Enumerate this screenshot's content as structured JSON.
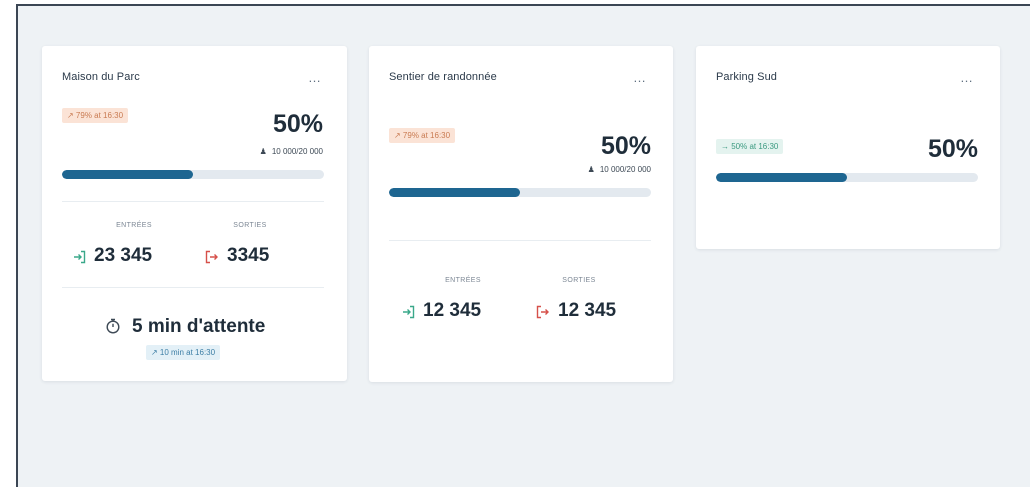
{
  "colors": {
    "background": "#eef2f5",
    "card": "#ffffff",
    "bar_fill": "#1e6691",
    "bar_track": "#e3e9ef",
    "trend_up": "#c97b52",
    "trend_flat": "#3b9a80",
    "entry_icon": "#3aa88a",
    "exit_icon": "#d6504a"
  },
  "cards": [
    {
      "title": "Maison du Parc",
      "menu": "…",
      "trend": "↗ 79% at 16:30",
      "percent": "50%",
      "percent_value": 50,
      "capacity": "10 000/20 000",
      "entries_label": "ENTRÉES",
      "exits_label": "SORTIES",
      "entries_value": "23 345",
      "exits_value": "3345",
      "wait": "5 min d'attente",
      "wait_trend": "↗ 10 min at 16:30"
    },
    {
      "title": "Sentier de randonnée",
      "menu": "…",
      "trend": "↗ 79% at 16:30",
      "percent": "50%",
      "percent_value": 50,
      "capacity": "10 000/20 000",
      "entries_label": "ENTRÉES",
      "exits_label": "SORTIES",
      "entries_value": "12 345",
      "exits_value": "12 345"
    },
    {
      "title": "Parking Sud",
      "menu": "…",
      "trend": "→ 50% at 16:30",
      "percent": "50%",
      "percent_value": 50
    }
  ]
}
